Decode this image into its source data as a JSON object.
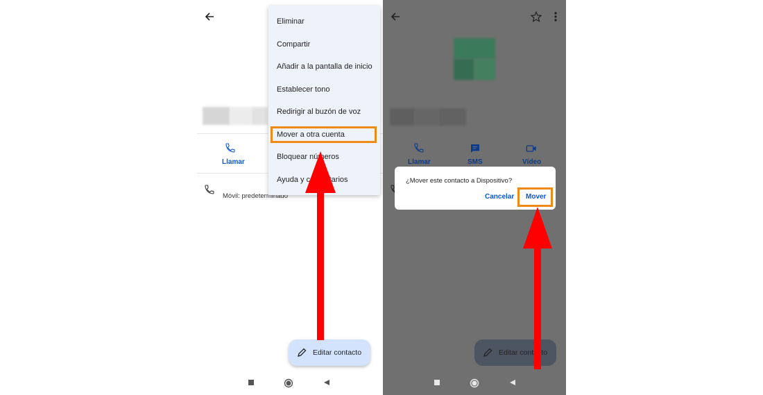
{
  "left_screen": {
    "menu_items": [
      "Eliminar",
      "Compartir",
      "Añadir a la pantalla de inicio",
      "Establecer tono",
      "Redirigir al buzón de voz",
      "Mover a otra cuenta",
      "Bloquear números",
      "Ayuda y comentarios"
    ],
    "quick_action_call": "Llamar",
    "phone_entry_label": "Móvil: predeterminado",
    "edit_button_label": "Editar contacto"
  },
  "right_screen": {
    "quick_actions": [
      "Llamar",
      "SMS",
      "Vídeo"
    ],
    "dialog_message": "¿Mover este contacto a Dispositivo?",
    "dialog_cancel": "Cancelar",
    "dialog_confirm": "Mover",
    "edit_button_label": "Editar contacto"
  },
  "colors": {
    "highlight": "#ef8a17",
    "arrow": "#ff0000",
    "accent": "#0b57d0",
    "menu_bg": "#eef2fb",
    "fab_bg": "#d3e3fd",
    "scrim": "#707070"
  },
  "icons": [
    "back-arrow-icon",
    "star-icon",
    "more-vert-icon",
    "phone-icon",
    "sms-icon",
    "video-icon",
    "edit-pencil-icon",
    "nav-square-icon",
    "nav-circle-icon",
    "nav-triangle-icon",
    "red-arrow"
  ]
}
